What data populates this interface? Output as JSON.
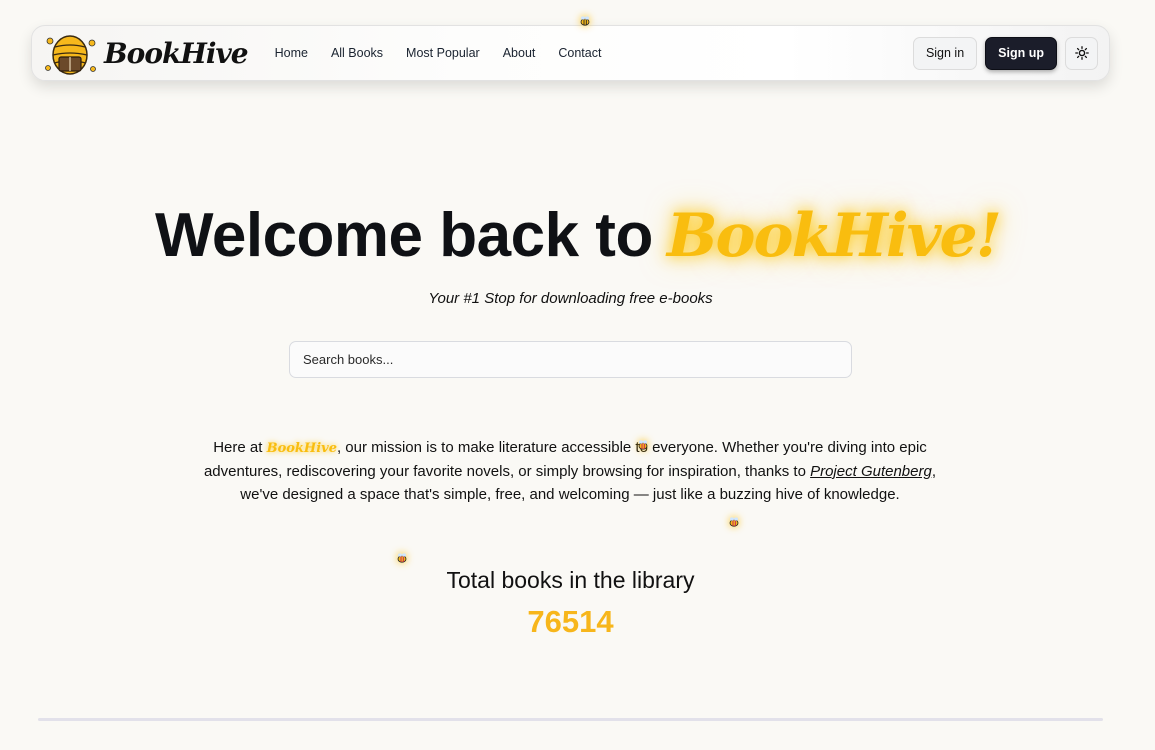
{
  "brand": {
    "name": "BookHive",
    "logo_icon": "beehive-book-icon"
  },
  "nav": {
    "links": [
      "Home",
      "All Books",
      "Most Popular",
      "About",
      "Contact"
    ],
    "sign_in": "Sign in",
    "sign_up": "Sign up",
    "theme_icon": "sun-icon"
  },
  "hero": {
    "title_prefix": "Welcome back to",
    "title_brand": "BookHive!",
    "tagline": "Your #1 Stop for downloading free e-books"
  },
  "search": {
    "placeholder": "Search books..."
  },
  "mission": {
    "intro": "Here at",
    "brand": "BookHive",
    "text_before_link": ", our mission is to make literature accessible to everyone. Whether you're diving into epic adventures, rediscovering your favorite novels, or simply browsing for inspiration, thanks to",
    "link": "Project Gutenberg",
    "text_after_link": ", we've designed a space that's simple, free, and welcoming — just like a buzzing hive of knowledge."
  },
  "stats": {
    "label": "Total books in the library",
    "count": "76514"
  },
  "colors": {
    "accent": "#f9bd0f",
    "dark_button": "#1b1d2a",
    "background": "#faf9f5"
  }
}
